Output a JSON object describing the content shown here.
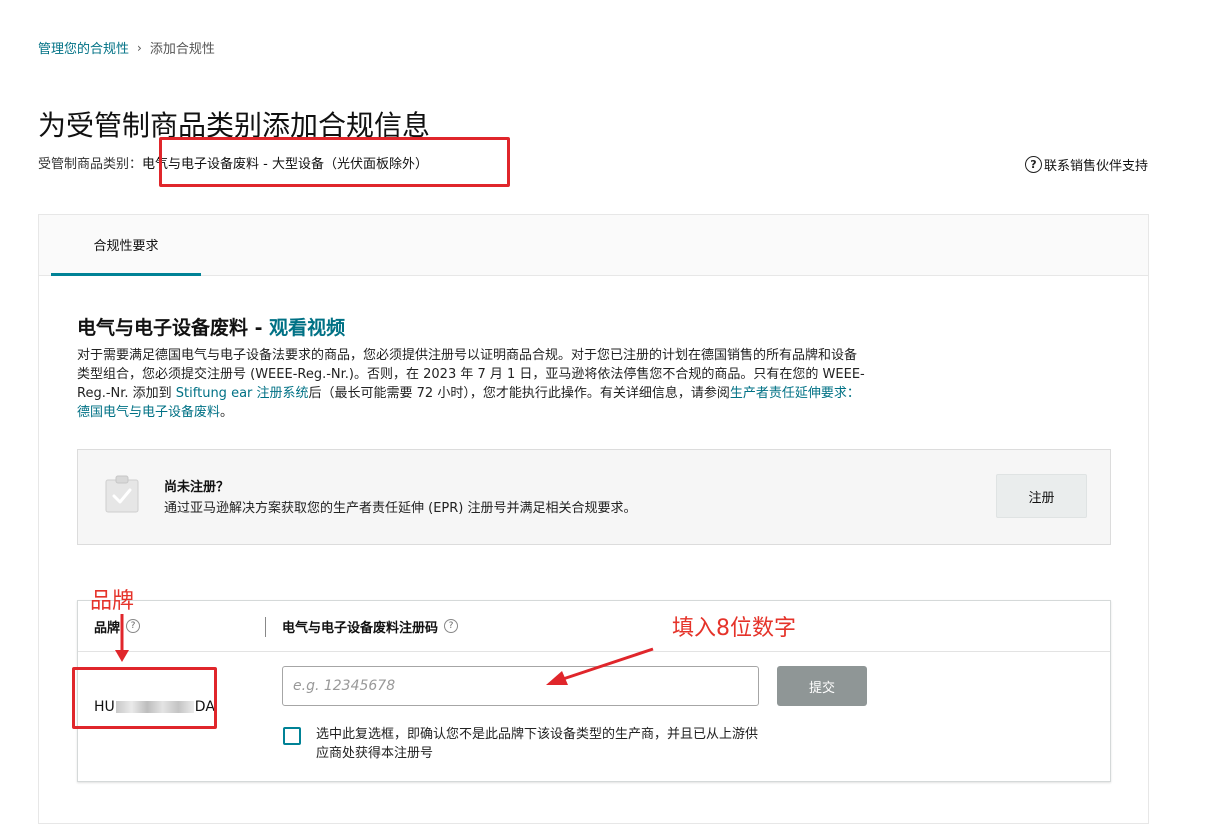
{
  "breadcrumb": {
    "parent": "管理您的合规性",
    "separator": "›",
    "current": "添加合规性"
  },
  "page_title": "为受管制商品类别添加合规信息",
  "category": {
    "label": "受管制商品类别：",
    "value": "电气与电子设备废料 - 大型设备（光伏面板除外）"
  },
  "support": {
    "icon": "?",
    "label": "联系销售伙伴支持"
  },
  "tabs": [
    {
      "label": "合规性要求",
      "active": true
    }
  ],
  "section": {
    "title": "电气与电子设备废料 - ",
    "video_link": "观看视频",
    "desc_1": "对于需要满足德国电气与电子设备法要求的商品，您必须提供注册号以证明商品合规。对于您已注册的计划在德国销售的所有品牌和设备类型组合，您必须提交注册号 (WEEE-Reg.-Nr.)。否则，在 2023 年 7 月 1 日，亚马逊将依法停售您不合规的商品。只有在您的 WEEE-Reg.-Nr. 添加到 ",
    "link_1": "Stiftung ear 注册系统",
    "desc_2": "后（最长可能需要 72 小时），您才能执行此操作。有关详细信息，请参阅",
    "link_2": "生产者责任延伸要求： 德国电气与电子设备废料",
    "desc_end": "。"
  },
  "notice": {
    "icon": "clipboard-check-icon",
    "title": "尚未注册？",
    "desc": "通过亚马逊解决方案获取您的生产者责任延伸 (EPR) 注册号并满足相关合规要求。",
    "button": "注册"
  },
  "brand_table": {
    "col_brand": "品牌",
    "col_reg": "电气与电子设备废料注册码",
    "help": "?",
    "brand_prefix": "HU",
    "brand_suffix": "DA",
    "input_placeholder": "e.g. 12345678",
    "input_value": "",
    "submit": "提交",
    "checkbox_label": "选中此复选框，即确认您不是此品牌下该设备类型的生产商，并且已从上游供应商处获得本注册号",
    "checkbox_checked": false
  },
  "annotations": {
    "brand_label": "品牌",
    "fill_hint": "填入8位数字",
    "color": "#e0262b"
  },
  "colors": {
    "link": "#007185",
    "tab_underline": "#008296",
    "submit_bg": "#8f9696"
  }
}
